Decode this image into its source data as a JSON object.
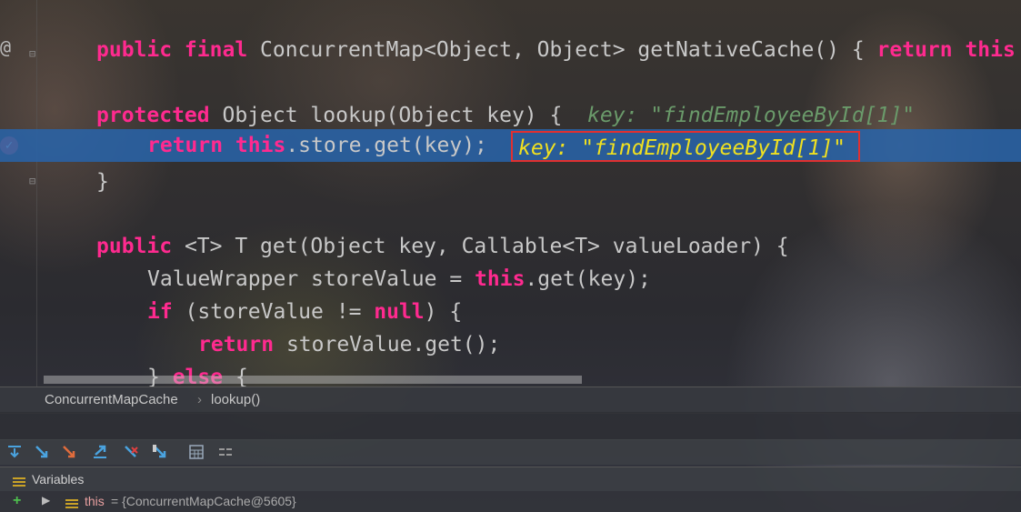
{
  "editor": {
    "lines": [
      {
        "kw1": "public final",
        "text": " ConcurrentMap<Object, Object> getNativeCache() { ",
        "kw2": "return this"
      },
      {
        "kw1": "protected",
        "text": " Object lookup(Object key) {  ",
        "hint": "key: \"findEmployeeById[1]\""
      },
      {
        "kw1": "return this",
        "text": ".store.get(key);",
        "inline": "key: \"findEmployeeById[1]\""
      },
      {
        "text": "}"
      },
      {
        "kw1": "public",
        "text": " <T> T get(Object key, Callable<T> valueLoader) {"
      },
      {
        "pre": "ValueWrapper storeValue = ",
        "kw1": "this",
        "text": ".get(key);"
      },
      {
        "kw1": "if",
        "text": " (storeValue != ",
        "kw2": "null",
        "post": ") {"
      },
      {
        "kw1": "return",
        "text": " storeValue.get();"
      },
      {
        "pre": "} ",
        "kw1": "else",
        "text": " {"
      }
    ]
  },
  "breadcrumb": {
    "class_name": "ConcurrentMapCache",
    "separator": "›",
    "method": "lookup()"
  },
  "variables": {
    "header": "Variables",
    "rows": [
      {
        "name": "this",
        "value": "= {ConcurrentMapCache@5605}"
      }
    ]
  },
  "icons": {
    "override": "at-icon",
    "breakpoint": "breakpoint-icon",
    "fold": "fold-icon"
  }
}
